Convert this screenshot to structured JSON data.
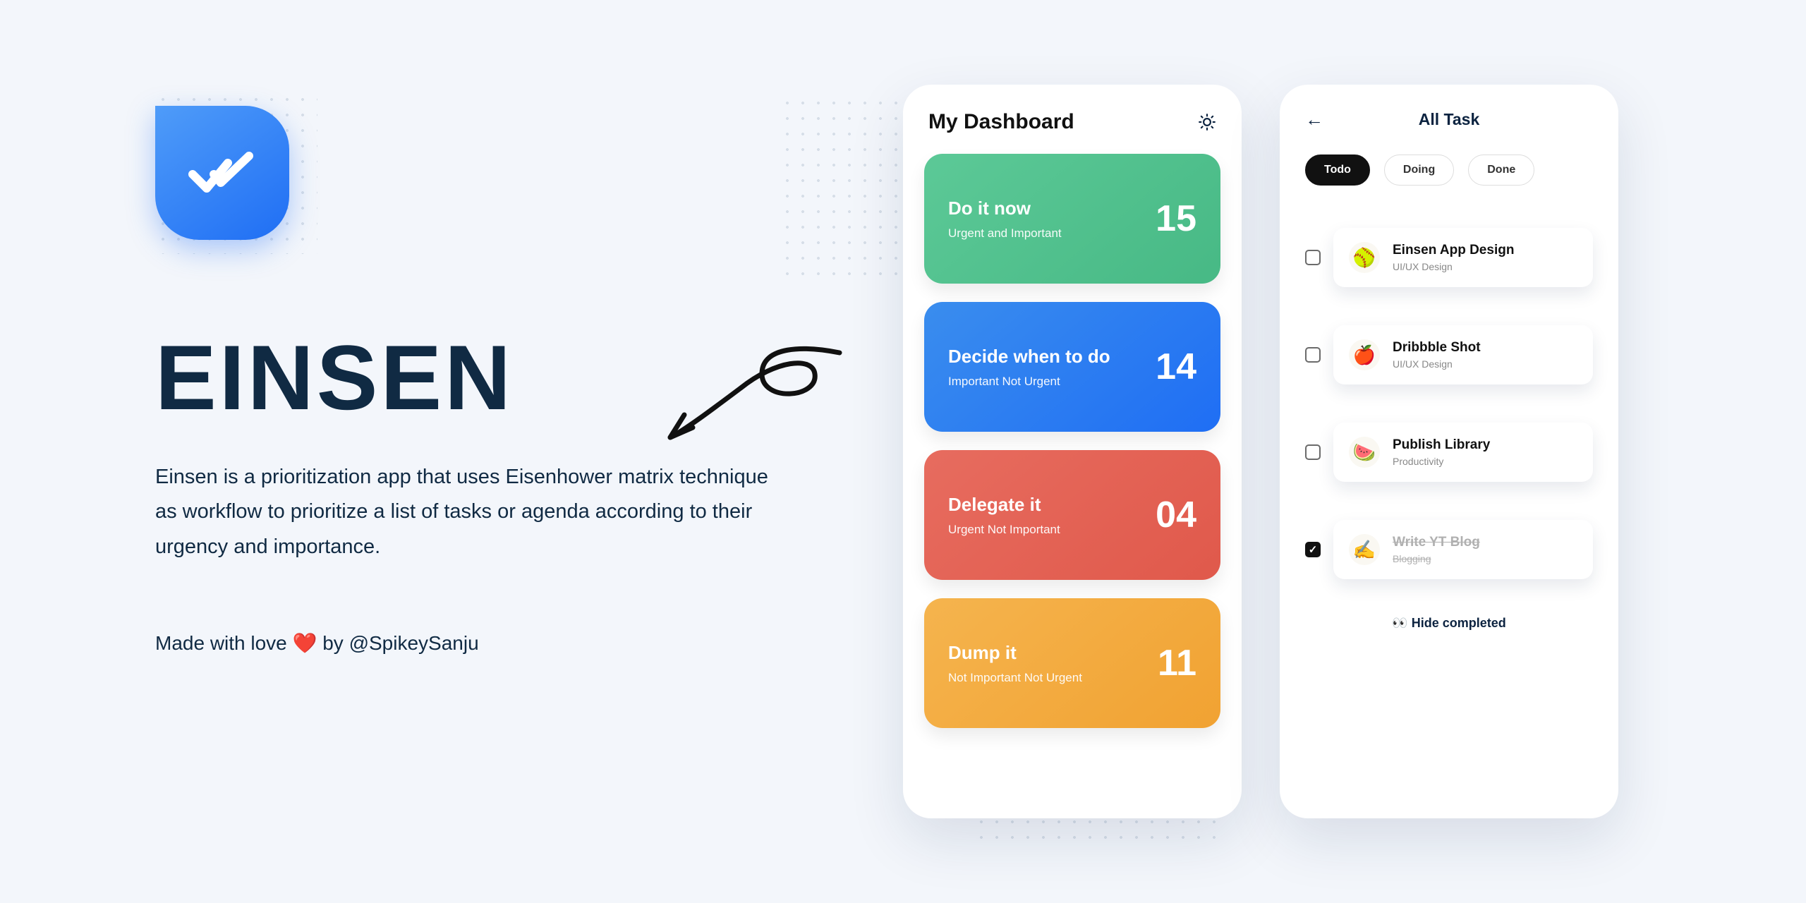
{
  "hero": {
    "app_name": "EINSEN",
    "description": "Einsen is a prioritization app that uses Eisenhower matrix technique as workflow to prioritize a list of tasks or agenda according to their urgency and importance.",
    "credits_prefix": "Made with love",
    "credits_emoji": "❤️",
    "credits_by": "by",
    "credits_handle": "@SpikeySanju"
  },
  "dashboard": {
    "title": "My Dashboard",
    "cards": [
      {
        "title": "Do it now",
        "subtitle": "Urgent and Important",
        "count": "15",
        "color": "green"
      },
      {
        "title": "Decide when to do",
        "subtitle": "Important Not Urgent",
        "count": "14",
        "color": "blue"
      },
      {
        "title": "Delegate it",
        "subtitle": "Urgent Not Important",
        "count": "04",
        "color": "red"
      },
      {
        "title": "Dump it",
        "subtitle": "Not Important Not Urgent",
        "count": "11",
        "color": "orange"
      }
    ]
  },
  "tasks": {
    "title": "All Task",
    "tabs": [
      {
        "label": "Todo",
        "active": true
      },
      {
        "label": "Doing",
        "active": false
      },
      {
        "label": "Done",
        "active": false
      }
    ],
    "items": [
      {
        "emoji": "🥎",
        "name": "Einsen App Design",
        "category": "UI/UX Design",
        "checked": false
      },
      {
        "emoji": "🍎",
        "name": "Dribbble Shot",
        "category": "UI/UX Design",
        "checked": false
      },
      {
        "emoji": "🍉",
        "name": "Publish Library",
        "category": "Productivity",
        "checked": false
      },
      {
        "emoji": "✍️",
        "name": "Write YT Blog",
        "category": "Blogging",
        "checked": true
      }
    ],
    "hide_completed_emoji": "👀",
    "hide_completed_label": "Hide completed"
  }
}
